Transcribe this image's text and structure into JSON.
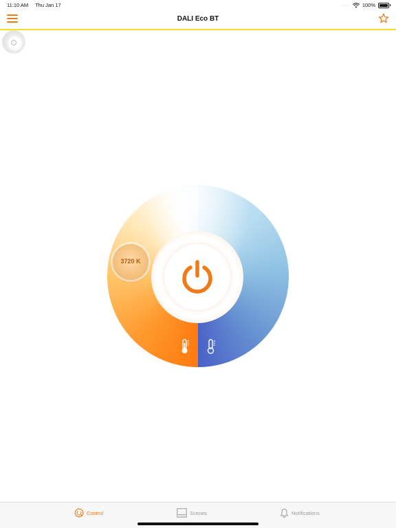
{
  "status_bar": {
    "time": "11:10 AM",
    "date": "Thu Jan 17",
    "battery": "100%"
  },
  "header": {
    "title": "DALI Eco BT",
    "menu_icon": "hamburger-menu-icon",
    "favorite_icon": "star-icon"
  },
  "controls": {
    "color_temperature_label": "3720 K",
    "power_icon": "power-icon",
    "warm_icon": "thermometer-warm-icon",
    "cool_icon": "thermometer-cool-icon"
  },
  "tabs": [
    {
      "label": "Control",
      "icon": "control-icon",
      "active": true
    },
    {
      "label": "Scenes",
      "icon": "scenes-icon",
      "active": false
    },
    {
      "label": "Notifications",
      "icon": "bell-icon",
      "active": false
    }
  ],
  "colors": {
    "accent": "#f07a1a",
    "header_line": "#f3e11c",
    "warm": "#ff7a0f",
    "cool": "#4a62c8"
  }
}
